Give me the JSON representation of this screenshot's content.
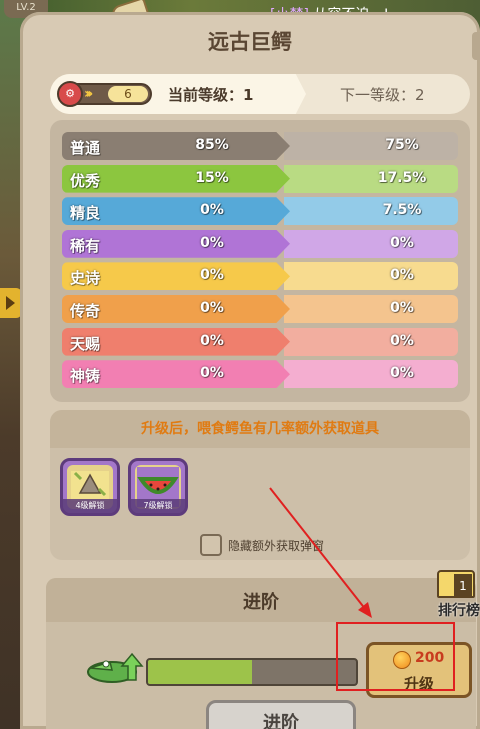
{
  "background": {
    "level_chip": "LV.2",
    "chat": {
      "name": "[小梦]",
      "message": "从容不迫，!"
    }
  },
  "panel": {
    "title": "远古巨鳄",
    "level_bar": {
      "badge_level": "6",
      "current": "当前等级：1",
      "next": "下一等级：2"
    },
    "rarity_rows": [
      {
        "label": "普通",
        "current": "85%",
        "next": "75%",
        "color_cur": "#8a7e72",
        "color_next": "#bdb2a6"
      },
      {
        "label": "优秀",
        "current": "15%",
        "next": "17.5%",
        "color_cur": "#8cc63f",
        "color_next": "#b9db83"
      },
      {
        "label": "精良",
        "current": "0%",
        "next": "7.5%",
        "color_cur": "#56a9d8",
        "color_next": "#93cbe8"
      },
      {
        "label": "稀有",
        "current": "0%",
        "next": "0%",
        "color_cur": "#b074d6",
        "color_next": "#d0a7e7"
      },
      {
        "label": "史诗",
        "current": "0%",
        "next": "0%",
        "color_cur": "#f6c94a",
        "color_next": "#f7db8f"
      },
      {
        "label": "传奇",
        "current": "0%",
        "next": "0%",
        "color_cur": "#f0a04b",
        "color_next": "#f4c48e"
      },
      {
        "label": "天赐",
        "current": "0%",
        "next": "0%",
        "color_cur": "#ef7f6d",
        "color_next": "#f2ae9f"
      },
      {
        "label": "神铸",
        "current": "0%",
        "next": "0%",
        "color_cur": "#f27fb2",
        "color_next": "#f4aed0"
      }
    ],
    "extra": {
      "header": "升级后，喂食鳄鱼有几率额外获取道具",
      "items": [
        {
          "icon": "clam-shell-icon",
          "tag": "4级解锁"
        },
        {
          "icon": "watermelon-icon",
          "tag": "7级解锁"
        }
      ],
      "hide_popup_label": "隐藏额外获取弹窗"
    },
    "advance": {
      "title": "进阶",
      "rank_label": "排行榜",
      "rank_number": "1",
      "progress": 0.5,
      "upgrade_cost": "200",
      "upgrade_label": "升级",
      "advance_button": "进阶"
    }
  }
}
